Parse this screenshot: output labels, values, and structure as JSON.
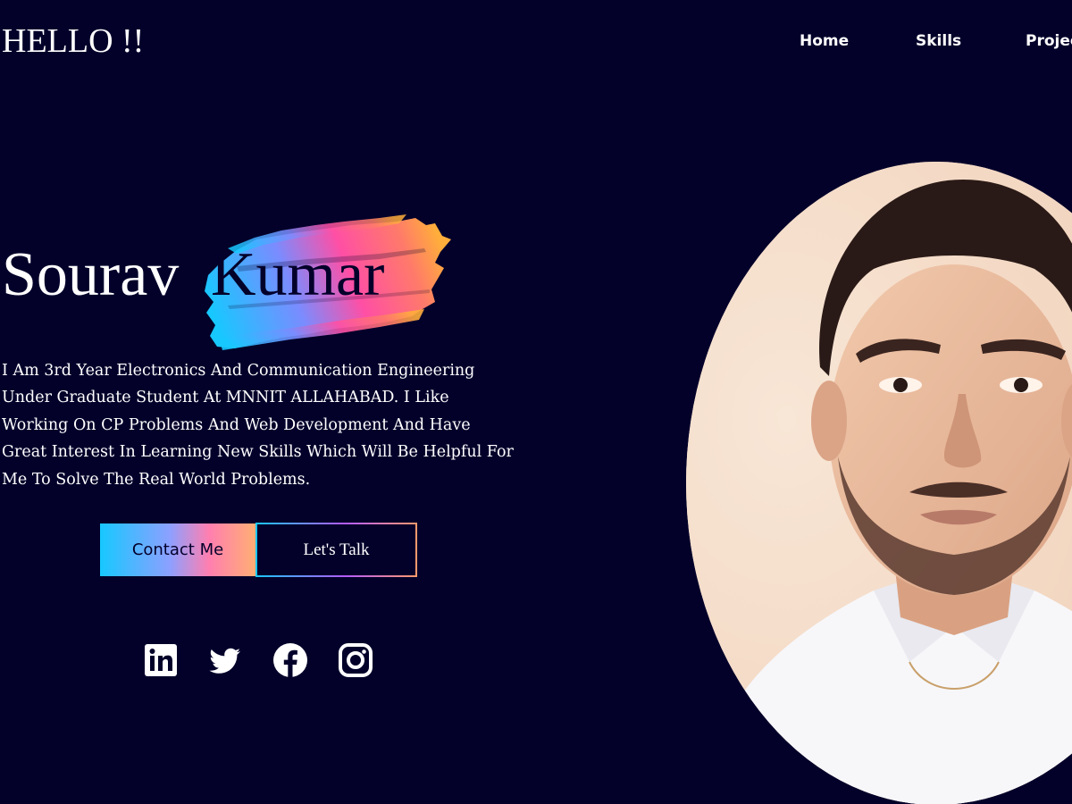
{
  "header": {
    "logo_text": "HELLO !!",
    "nav": [
      {
        "label": "Home"
      },
      {
        "label": "Skills"
      },
      {
        "label": "Projects"
      }
    ]
  },
  "hero": {
    "first_name": "Sourav",
    "last_name": "Kumar",
    "bio": "I Am 3rd Year Electronics And Communication Engineering Under Graduate Student At MNNIT ALLAHABAD. I Like Working On CP Problems And Web Development And Have Great Interest In Learning New Skills Which Will Be Helpful For Me To Solve The Real World Problems.",
    "buttons": {
      "contact_label": "Contact Me",
      "talk_label": "Let's Talk"
    }
  },
  "social": [
    {
      "icon": "linkedin-icon"
    },
    {
      "icon": "twitter-icon"
    },
    {
      "icon": "facebook-icon"
    },
    {
      "icon": "instagram-icon"
    }
  ],
  "colors": {
    "background": "#03002a",
    "text": "#ffffff",
    "gradient_start": "#17c8ff",
    "gradient_mid": "#ff4fa5",
    "gradient_end": "#ffae3b"
  }
}
